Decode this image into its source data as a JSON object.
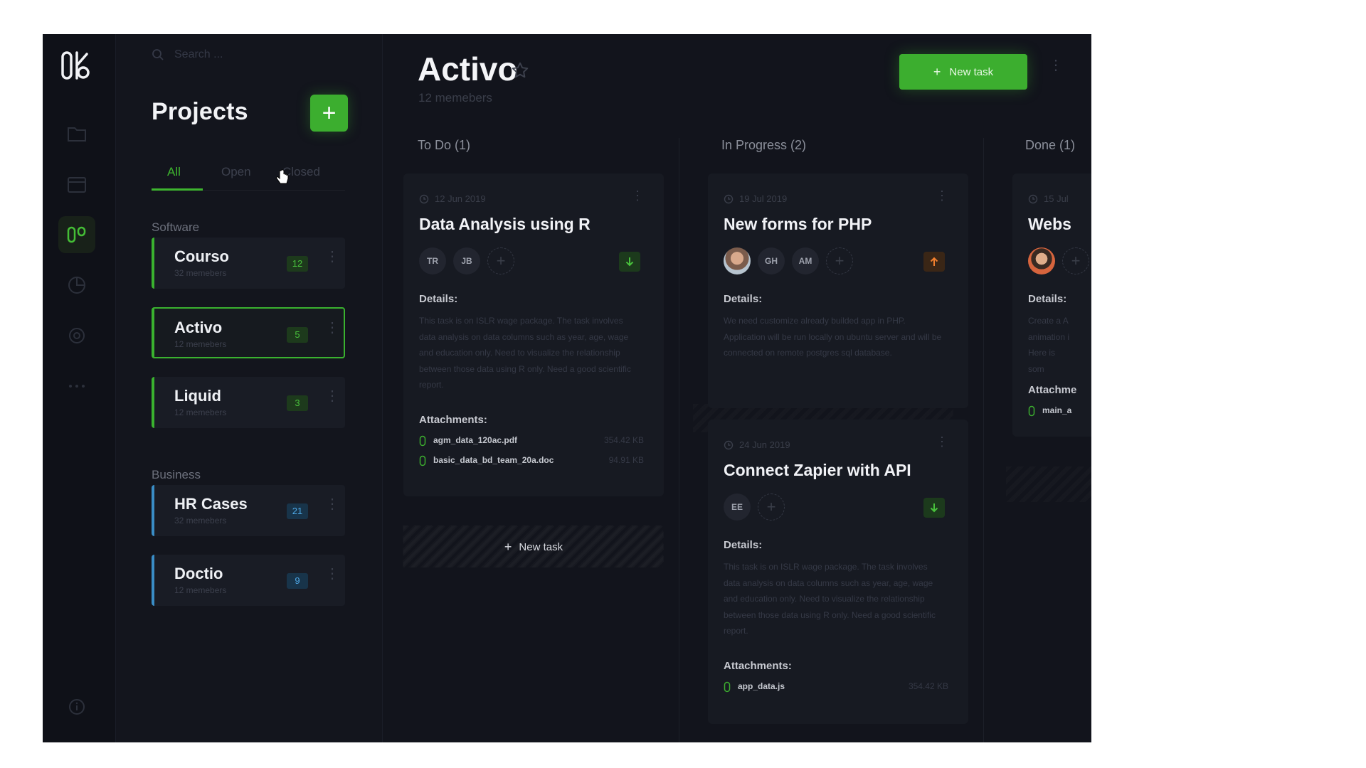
{
  "search": {
    "placeholder": "Search ..."
  },
  "projects": {
    "title": "Projects",
    "add_label": "+",
    "tabs": [
      {
        "label": "All"
      },
      {
        "label": "Open"
      },
      {
        "label": "Closed"
      }
    ],
    "groups": [
      {
        "label": "Software"
      },
      {
        "label": "Business"
      }
    ],
    "items": [
      {
        "name": "Courso",
        "members": "32 memebers",
        "count": "12"
      },
      {
        "name": "Activo",
        "members": "12 memebers",
        "count": "5"
      },
      {
        "name": "Liquid",
        "members": "12 memebers",
        "count": "3"
      },
      {
        "name": "HR Cases",
        "members": "32 memebers",
        "count": "21"
      },
      {
        "name": "Doctio",
        "members": "12 memebers",
        "count": "9"
      }
    ]
  },
  "board": {
    "title": "Activo",
    "subtitle": "12 memebers",
    "new_task_label": "New task",
    "columns": [
      {
        "label": "To Do (1)"
      },
      {
        "label": "In Progress (2)"
      },
      {
        "label": "Done (1)"
      }
    ],
    "column_new_task": "New task",
    "tasks": [
      {
        "date": "12 Jun 2019",
        "title": "Data Analysis using R",
        "avatars": [
          "TR",
          "JB"
        ],
        "details_label": "Details:",
        "details": "This task is on ISLR wage package. The task involves data analysis on data columns such as year, age, wage and education only. Need to visualize the relationship between those data using R only. Need a good scientific report.",
        "attachments_label": "Attachments:",
        "attachments": [
          {
            "name": "agm_data_120ac.pdf",
            "size": "354.42 KB"
          },
          {
            "name": "basic_data_bd_team_20a.doc",
            "size": "94.91 KB"
          }
        ]
      },
      {
        "date": "19 Jul 2019",
        "title": "New forms for PHP",
        "avatars": [
          "GH",
          "AM"
        ],
        "details_label": "Details:",
        "details": "We need customize already builded app in PHP. Application will be run locally on ubuntu server and will be connected on remote postgres sql database."
      },
      {
        "date": "24 Jun 2019",
        "title": "Connect Zapier with API",
        "avatars": [
          "EE"
        ],
        "details_label": "Details:",
        "details": "This task is on ISLR wage package. The task involves data analysis on data columns such as year, age, wage and education only. Need to visualize the relationship between those data using R only. Need a good scientific report.",
        "attachments_label": "Attachments:",
        "attachments": [
          {
            "name": "app_data.js",
            "size": "354.42 KB"
          }
        ]
      },
      {
        "date": "15 Jul",
        "title": "Webs",
        "details_label": "Details:",
        "details": "Create a A animation i Here is som",
        "attachments_label": "Attachme",
        "attachments": [
          {
            "name": "main_a"
          }
        ]
      }
    ]
  },
  "colors": {
    "accent": "#3cae2f",
    "background": "#12141c",
    "card": "#171a22",
    "blue": "#3a8dc6",
    "orange": "#f07f2e"
  },
  "icons": [
    "logo-icon",
    "search-icon",
    "folder-icon",
    "calendar-icon",
    "board-icon",
    "chart-icon",
    "settings-icon",
    "more-icon",
    "info-icon",
    "star-icon",
    "clock-icon",
    "paperclip-icon",
    "arrow-down-icon",
    "arrow-up-icon",
    "plus-icon"
  ]
}
